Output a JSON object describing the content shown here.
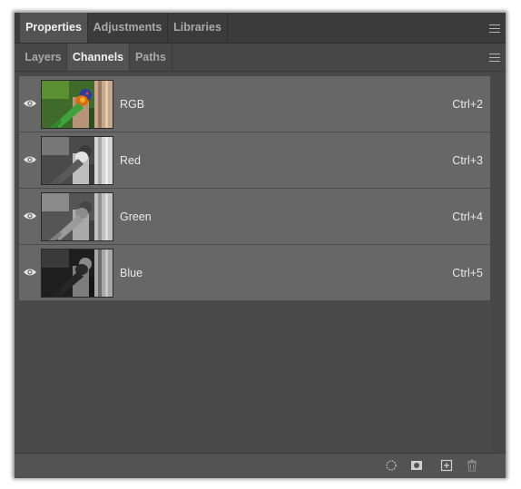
{
  "panel_tabs": [
    {
      "label": "Properties",
      "active": true
    },
    {
      "label": "Adjustments",
      "active": false
    },
    {
      "label": "Libraries",
      "active": false
    }
  ],
  "sub_tabs": [
    {
      "label": "Layers",
      "active": false
    },
    {
      "label": "Channels",
      "active": true
    },
    {
      "label": "Paths",
      "active": false
    }
  ],
  "channels": [
    {
      "name": "RGB",
      "shortcut": "Ctrl+2",
      "visible": true,
      "thumb": "color"
    },
    {
      "name": "Red",
      "shortcut": "Ctrl+3",
      "visible": true,
      "thumb": "gray-light"
    },
    {
      "name": "Green",
      "shortcut": "Ctrl+4",
      "visible": true,
      "thumb": "gray-mid"
    },
    {
      "name": "Blue",
      "shortcut": "Ctrl+5",
      "visible": true,
      "thumb": "gray-dark"
    }
  ],
  "footer_icons": [
    "load-channel-as-selection-icon",
    "save-selection-as-channel-icon",
    "create-new-channel-icon",
    "delete-channel-icon"
  ],
  "colors": {
    "panel_bg": "#535353",
    "tab_bar_bg": "#3b3b3b",
    "row_bg": "#676767",
    "text": "#e8e8e8"
  }
}
